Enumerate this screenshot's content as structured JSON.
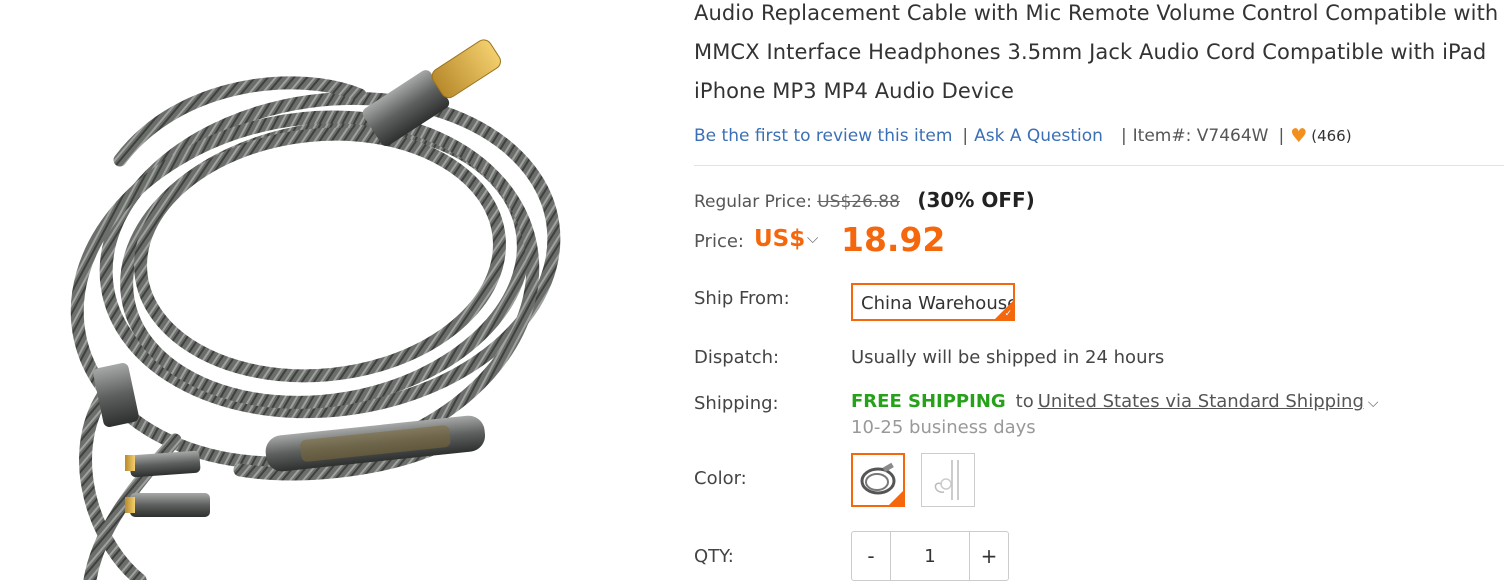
{
  "product": {
    "title": "Audio Replacement Cable with Mic Remote Volume Control Compatible with MMCX Interface Headphones 3.5mm Jack Audio Cord Compatible with iPad iPhone MP3 MP4 Audio Device",
    "review_link": "Be the first to review this item",
    "ask_link": "Ask A Question",
    "item_number": "Item#: V7464W",
    "favorites_count": "(466)"
  },
  "pricing": {
    "regular_label": "Regular Price:",
    "regular_price": "US$26.88",
    "discount": "(30% OFF)",
    "price_label": "Price:",
    "currency": "US$",
    "price": "18.92"
  },
  "ship_from": {
    "label": "Ship From:",
    "value": "China Warehouse"
  },
  "dispatch": {
    "label": "Dispatch:",
    "value": "Usually will be shipped in 24 hours"
  },
  "shipping": {
    "label": "Shipping:",
    "free": "FREE SHIPPING",
    "to": "to",
    "destination": "United States via Standard Shipping",
    "days": "10-25 business days"
  },
  "color": {
    "label": "Color:",
    "options": [
      "black braided cable",
      "white cable"
    ],
    "selected": 0
  },
  "qty": {
    "label": "QTY:",
    "value": "1",
    "minus": "-",
    "plus": "+"
  },
  "colors": {
    "accent": "#f5670c",
    "link": "#3b6fb6",
    "free_shipping": "#26a11a",
    "heart": "#f38f1d"
  },
  "icons": [
    "heart-icon",
    "chevron-down-icon",
    "checkmark-corner-icon"
  ]
}
